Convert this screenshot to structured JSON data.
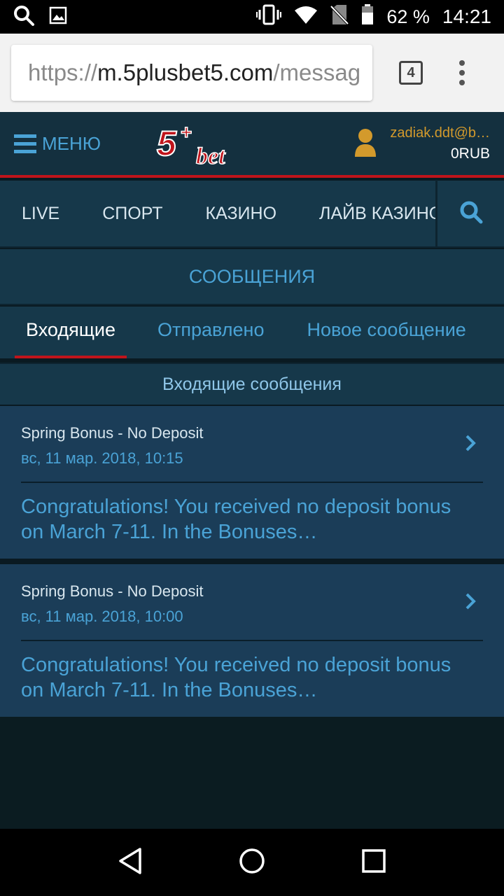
{
  "status_bar": {
    "battery": "62 %",
    "time": "14:21"
  },
  "browser": {
    "url_scheme": "https://",
    "url_host": "m.5plusbet5.com",
    "url_path": "/messag",
    "tab_count": "4"
  },
  "header": {
    "menu_label": "МЕНЮ",
    "account_email": "zadiak.ddt@b…",
    "account_balance": "0RUB"
  },
  "nav": {
    "items": [
      "LIVE",
      "СПОРТ",
      "КАЗИНО",
      "ЛАЙВ КАЗИНО"
    ]
  },
  "page": {
    "title": "СООБЩЕНИЯ"
  },
  "tabs": [
    {
      "label": "Входящие"
    },
    {
      "label": "Отправлено"
    },
    {
      "label": "Новое сообщение"
    }
  ],
  "section_header": "Входящие сообщения",
  "messages": [
    {
      "subject": "Spring Bonus - No Deposit",
      "date": "вс, 11 мар. 2018, 10:15",
      "preview": "Congratulations! You received no deposit bonus on March 7-11. In the Bonuses…"
    },
    {
      "subject": "Spring Bonus - No Deposit",
      "date": "вс, 11 мар. 2018, 10:00",
      "preview": "Congratulations! You received no deposit bonus on March 7-11. In the Bonuses…"
    }
  ],
  "colors": {
    "accent": "#4aa3d6",
    "brand_red": "#c0141b",
    "header_bg": "#14303f",
    "message_bg": "#1b3d58"
  }
}
